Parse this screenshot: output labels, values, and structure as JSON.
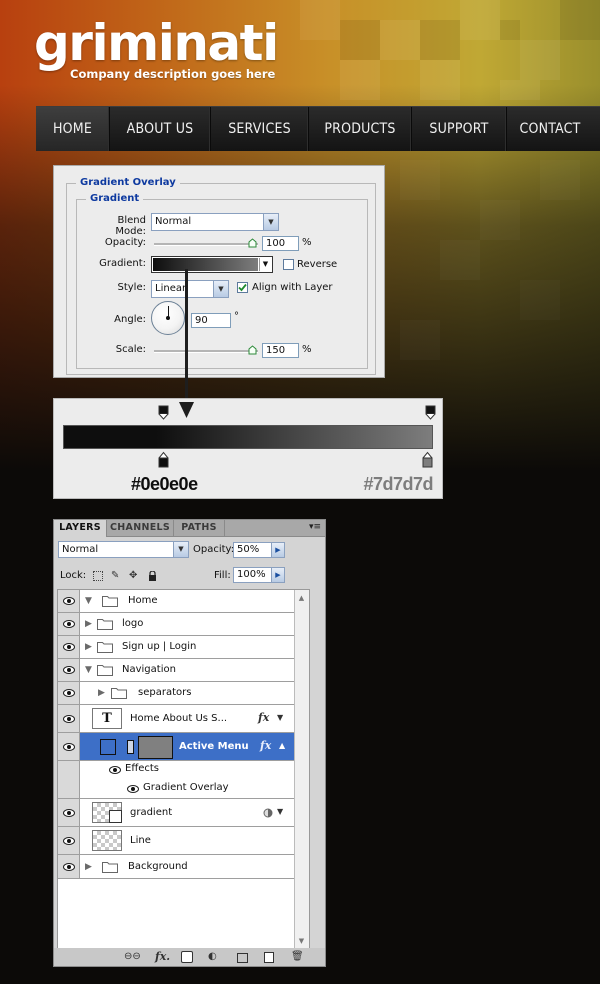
{
  "site": {
    "logo": "griminati",
    "tagline": "Company description goes here"
  },
  "nav": {
    "items": [
      {
        "label": "HOME",
        "active": true
      },
      {
        "label": "ABOUT US",
        "active": false
      },
      {
        "label": "SERVICES",
        "active": false
      },
      {
        "label": "PRODUCTS",
        "active": false
      },
      {
        "label": "SUPPORT",
        "active": false
      },
      {
        "label": "CONTACT",
        "active": false
      }
    ]
  },
  "gradient_overlay": {
    "title": "Gradient Overlay",
    "section": "Gradient",
    "blend_mode_label": "Blend Mode:",
    "blend_mode": "Normal",
    "opacity_label": "Opacity:",
    "opacity": "100",
    "opacity_unit": "%",
    "gradient_label": "Gradient:",
    "reverse_label": "Reverse",
    "reverse_checked": false,
    "style_label": "Style:",
    "style": "Linear",
    "align_label": "Align with Layer",
    "align_checked": true,
    "angle_label": "Angle:",
    "angle": "90",
    "angle_unit": "°",
    "scale_label": "Scale:",
    "scale": "150",
    "scale_unit": "%"
  },
  "gradient_editor": {
    "start_color": "#0e0e0e",
    "end_color": "#7d7d7d",
    "start_label": "#0e0e0e",
    "end_label": "#7d7d7d"
  },
  "layers_panel": {
    "tabs": [
      "LAYERS",
      "CHANNELS",
      "PATHS"
    ],
    "active_tab": "LAYERS",
    "blend_mode": "Normal",
    "opacity_label": "Opacity:",
    "opacity": "50%",
    "lock_label": "Lock:",
    "fill_label": "Fill:",
    "fill": "100%",
    "layers": {
      "home": "Home",
      "logo": "logo",
      "signup": "Sign up   |   Login",
      "navigation": "Navigation",
      "separators": "separators",
      "text_layer": "Home      About Us      S...",
      "active_menu": "Active Menu",
      "effects": "Effects",
      "gradient_overlay": "Gradient Overlay",
      "gradient": "gradient",
      "line": "Line",
      "background": "Background"
    },
    "text_thumb": "T"
  },
  "colors": {
    "selected_row": "#3d6fc7",
    "accent_blue": "#0e3aa0"
  }
}
